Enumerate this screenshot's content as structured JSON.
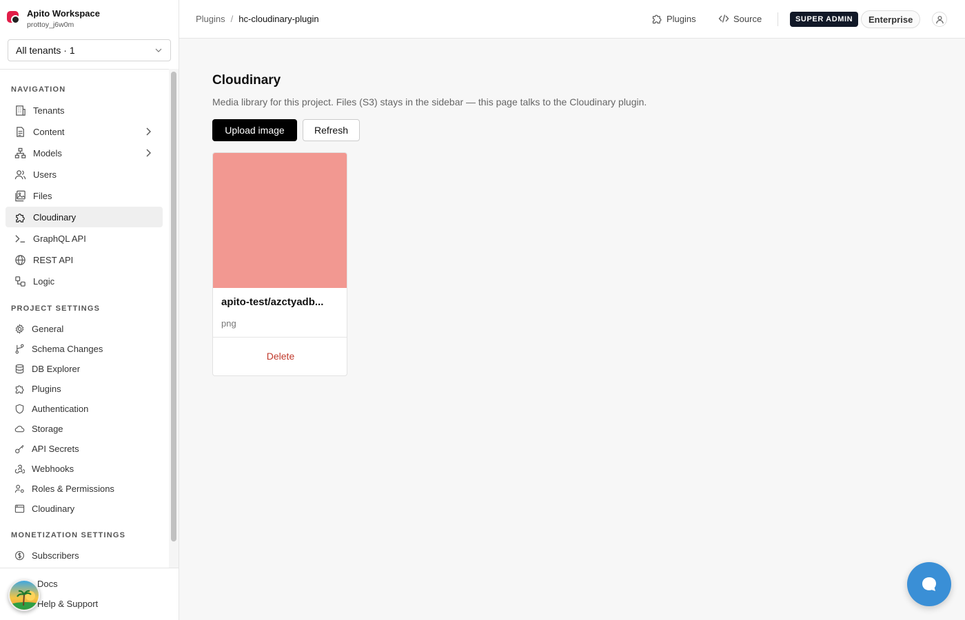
{
  "workspace": {
    "name": "Apito Workspace",
    "user": "prottoy_j6w0m"
  },
  "tenant_select": {
    "value": "All tenants · 1"
  },
  "sidebar": {
    "navigation_title": "NAVIGATION",
    "nav_items": [
      {
        "label": "Tenants",
        "icon": "building-icon"
      },
      {
        "label": "Content",
        "icon": "file-icon",
        "has_children": true
      },
      {
        "label": "Models",
        "icon": "hierarchy-icon",
        "has_children": true
      },
      {
        "label": "Users",
        "icon": "users-icon"
      },
      {
        "label": "Files",
        "icon": "image-icon"
      },
      {
        "label": "Cloudinary",
        "icon": "puzzle-icon",
        "active": true
      },
      {
        "label": "GraphQL API",
        "icon": "terminal-icon"
      },
      {
        "label": "REST API",
        "icon": "globe-icon"
      },
      {
        "label": "Logic",
        "icon": "workflow-icon"
      }
    ],
    "project_settings_title": "PROJECT SETTINGS",
    "settings_items": [
      {
        "label": "General",
        "icon": "gear-icon"
      },
      {
        "label": "Schema Changes",
        "icon": "branch-icon"
      },
      {
        "label": "DB Explorer",
        "icon": "database-icon"
      },
      {
        "label": "Plugins",
        "icon": "puzzle-icon"
      },
      {
        "label": "Authentication",
        "icon": "shield-icon"
      },
      {
        "label": "Storage",
        "icon": "cloud-icon"
      },
      {
        "label": "API Secrets",
        "icon": "key-icon"
      },
      {
        "label": "Webhooks",
        "icon": "webhook-icon"
      },
      {
        "label": "Roles & Permissions",
        "icon": "roles-icon"
      },
      {
        "label": "Cloudinary",
        "icon": "window-icon"
      }
    ],
    "monetization_title": "MONETIZATION SETTINGS",
    "monetization_items": [
      {
        "label": "Subscribers",
        "icon": "dollar-icon"
      }
    ],
    "bottom_links": {
      "docs": "Docs",
      "help": "Help & Support"
    }
  },
  "topbar": {
    "breadcrumb": {
      "parent": "Plugins",
      "separator": "/",
      "current": "hc-cloudinary-plugin"
    },
    "plugins_link": "Plugins",
    "source_link": "Source",
    "role_badge": "SUPER ADMIN",
    "plan_badge": "Enterprise"
  },
  "main": {
    "title": "Cloudinary",
    "description": "Media library for this project. Files (S3) stays in the sidebar — this page talks to the Cloudinary plugin.",
    "upload_button": "Upload image",
    "refresh_button": "Refresh",
    "assets": [
      {
        "name": "apito-test/azctyadb...",
        "format": "png",
        "thumb_color": "#f29891",
        "delete_label": "Delete"
      }
    ]
  },
  "colors": {
    "accent": "#000000",
    "danger": "#c0392b",
    "chat": "#3a8fd6",
    "active_bg": "#efefef"
  }
}
